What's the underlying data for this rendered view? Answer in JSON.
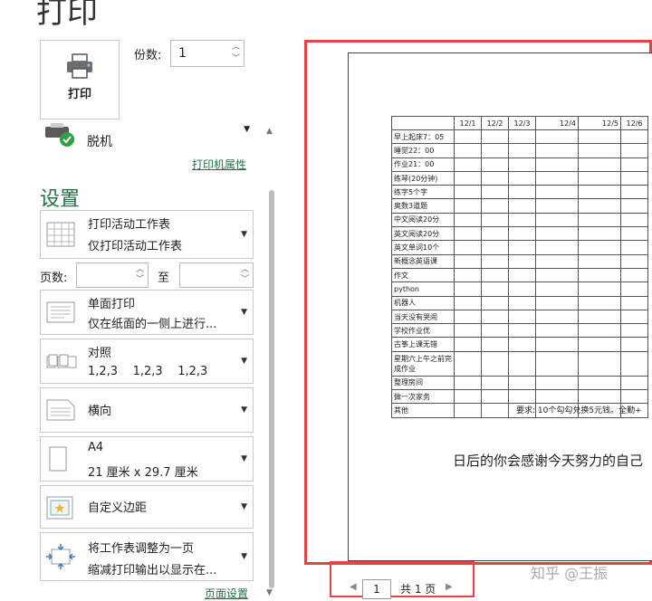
{
  "page_title": "打印",
  "print_button_label": "打印",
  "copies": {
    "label": "份数:",
    "value": "1"
  },
  "printer": {
    "status": "脱机",
    "properties_link": "打印机属性"
  },
  "settings_title": "设置",
  "options": [
    {
      "line1": "打印活动工作表",
      "line2": "仅打印活动工作表"
    },
    {
      "line1": "单面打印",
      "line2": "仅在纸面的一侧上进行..."
    },
    {
      "line1": "对照",
      "line2": "1,2,3    1,2,3    1,2,3"
    },
    {
      "line1": "横向",
      "line2": ""
    },
    {
      "line1": "A4",
      "line2": "21 厘米 x 29.7 厘米"
    },
    {
      "line1": "自定义边距",
      "line2": ""
    },
    {
      "line1": "将工作表调整为一页",
      "line2": "缩减打印输出以显示在..."
    }
  ],
  "pages": {
    "label": "页数:",
    "to": "至"
  },
  "page_setup_link": "页面设置",
  "preview": {
    "headers": [
      "",
      "12/1",
      "12/2",
      "12/3",
      "12/4",
      "12/5",
      "12/6"
    ],
    "rows": [
      "早上起床7：05",
      "睡觉22：00",
      "作业21：00",
      "练琴(20分钟)",
      "练字5个字",
      "奥数3道题",
      "中文阅读20分",
      "英文阅读20分",
      "英文单词10个",
      "新概念英语课",
      "作文",
      "python",
      "机器人",
      "当天没有哭闹",
      "学校作业优",
      "古筝上课无错",
      "星期六上午之前完成作业",
      "整理房间",
      "做一次家务",
      "其他"
    ],
    "requirement": "要求:   10个勾勾兑换5元钱。全勤+",
    "motto": "日后的你会感谢今天努力的自己"
  },
  "pager": {
    "current": "1",
    "total": "共 1 页",
    "prev": "◀",
    "next": "▶"
  },
  "watermark": "知乎 @王振"
}
